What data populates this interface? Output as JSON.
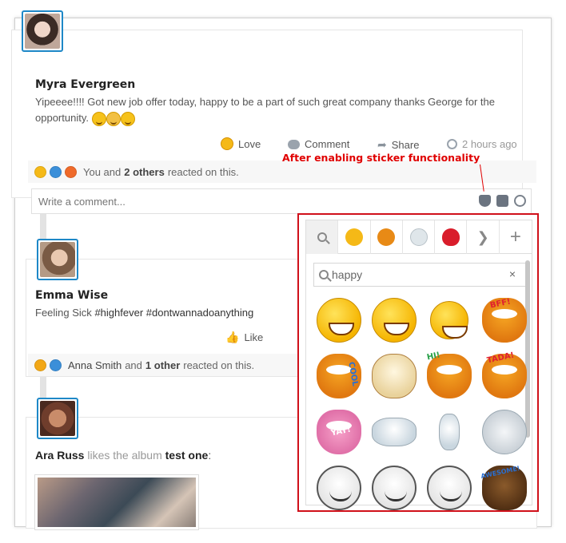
{
  "posts": [
    {
      "author": "Myra Evergreen",
      "text": "Yipeeee!!!! Got new job offer today, happy to be a part of such great company thanks George for the opportunity.",
      "actions": {
        "love": "Love",
        "comment": "Comment",
        "share": "Share",
        "time": "2 hours ago"
      },
      "reactions": {
        "prefix": "You and",
        "count_text": "2 others",
        "suffix": "reacted on this."
      },
      "comment_placeholder": "Write a comment..."
    },
    {
      "author": "Emma Wise",
      "text_prefix": "Feeling Sick",
      "hashtags": "#highfever #dontwannadoanything",
      "actions": {
        "like": "Like"
      },
      "reactions": {
        "user": "Anna Smith",
        "mid": "and",
        "count_text": "1 other",
        "suffix": "reacted on this."
      }
    },
    {
      "author": "Ara Russ",
      "activity": "likes the album",
      "album_name": "test one",
      "colon": ":"
    }
  ],
  "annotation": "After enabling sticker functionality",
  "sticker_panel": {
    "tabs": [
      "search-icon",
      "emoji-pack",
      "garfield-pack",
      "snowman-pack",
      "heart-pack",
      "next-arrow",
      "add-pack"
    ],
    "search_value": "happy",
    "clear_label": "×",
    "stickers": [
      {
        "name": "big-grin-smiley",
        "label": ""
      },
      {
        "name": "peace-sign-smiley",
        "label": ""
      },
      {
        "name": "dancing-smiley",
        "label": ""
      },
      {
        "name": "garfield-bff",
        "label": "BFF!"
      },
      {
        "name": "garfield-cool",
        "label": "COOL"
      },
      {
        "name": "odie-dog",
        "label": ""
      },
      {
        "name": "garfield-hi",
        "label": "HI!"
      },
      {
        "name": "garfield-tada",
        "label": "TADA!"
      },
      {
        "name": "garfield-yay",
        "label": "YAY!"
      },
      {
        "name": "olaf-lying",
        "label": ""
      },
      {
        "name": "olaf-standing",
        "label": ""
      },
      {
        "name": "olaf-round",
        "label": ""
      },
      {
        "name": "meme-face-happy",
        "label": ""
      },
      {
        "name": "meme-face-laugh",
        "label": ""
      },
      {
        "name": "meme-face-shy",
        "label": ""
      },
      {
        "name": "kung-fu-panda-awesome",
        "label": "AWESOME!"
      }
    ]
  },
  "colors": {
    "accent": "#1e88c7",
    "annotation": "#e00000",
    "panel_border": "#d0101a"
  }
}
